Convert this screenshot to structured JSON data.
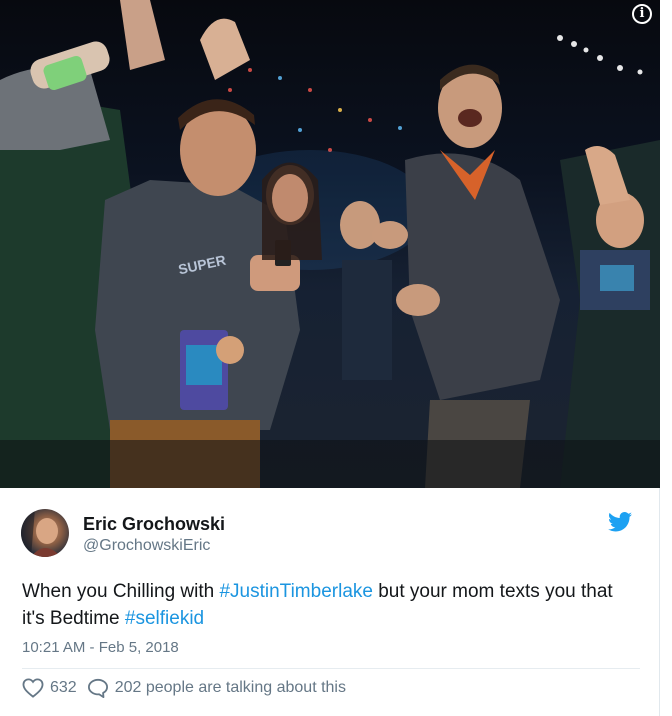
{
  "photo": {
    "alt_description_icon": "info-icon",
    "info_glyph": "i",
    "shirt_text": "SUPER"
  },
  "tweet": {
    "author_name": "Eric Grochowski",
    "author_handle": "@GrochowskiEric",
    "text_before": "When you Chilling with ",
    "hashtag1": "#JustinTimberlake",
    "text_middle": " but your mom texts you that it's Bedtime ",
    "hashtag2": "#selfiekid",
    "timestamp": "10:21 AM - Feb 5, 2018",
    "like_count": "632",
    "reply_text": "202 people are talking about this"
  },
  "icons": {
    "info": "info-icon",
    "bird": "twitter-bird-icon",
    "like": "heart-icon",
    "reply": "reply-bubble-icon"
  },
  "colors": {
    "link": "#1b95e0",
    "secondary_text": "#657786",
    "primary_text": "#14171a",
    "twitter_blue": "#1da1f2"
  }
}
